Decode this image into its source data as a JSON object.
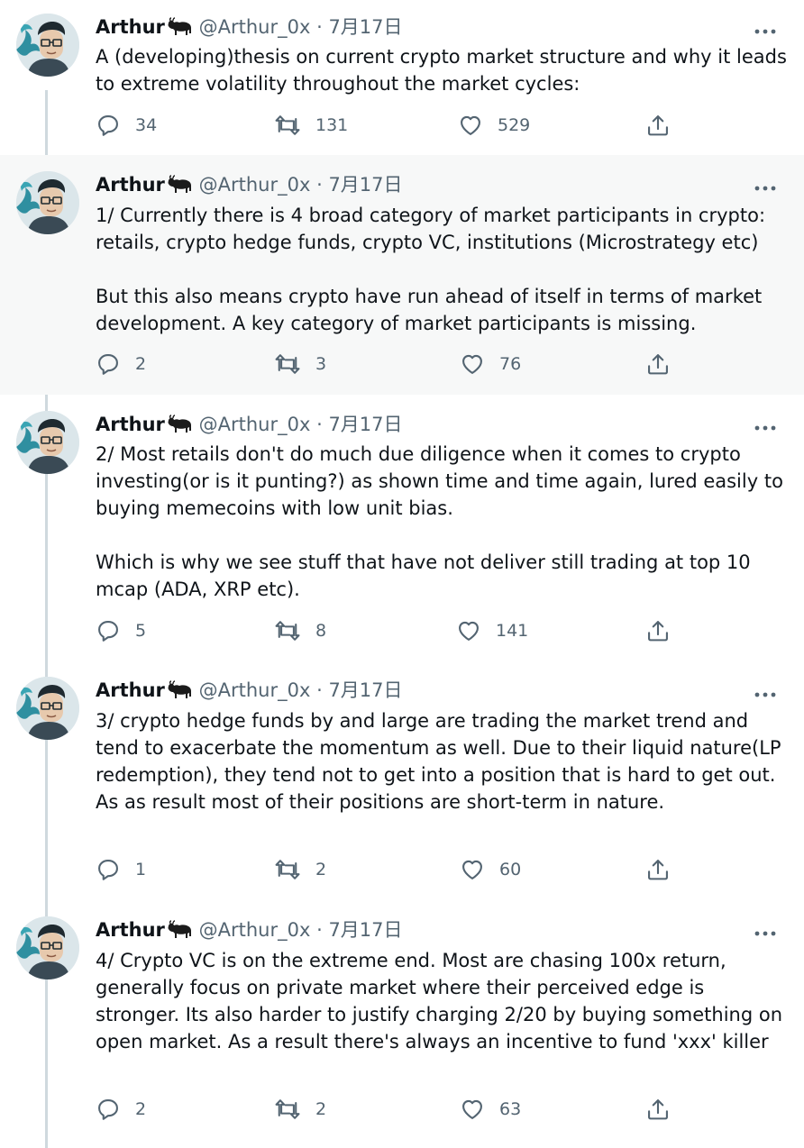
{
  "user": {
    "name": "Arthur",
    "handle": "@Arthur_0x",
    "separator": "·",
    "name_badge_icon": "bull-emoji"
  },
  "labels": {
    "more_icon": "more-options-icon",
    "reply_icon": "reply-icon",
    "retweet_icon": "retweet-icon",
    "like_icon": "heart-icon",
    "share_icon": "share-icon"
  },
  "colors": {
    "text": "#0f1419",
    "secondary": "#536471",
    "thread_line": "#cfd9de",
    "highlight_bg": "#f7f8f8"
  },
  "tweets": [
    {
      "date": "7月17日",
      "paragraphs": [
        "A (developing)thesis on current crypto market structure and why it leads to extreme volatility throughout the market cycles:"
      ],
      "replies": "34",
      "retweets": "131",
      "likes": "529"
    },
    {
      "date": "7月17日",
      "paragraphs": [
        "1/ Currently there is 4 broad category of market participants in crypto: retails, crypto hedge funds, crypto VC, institutions (Microstrategy etc)",
        "But this also means crypto have run ahead of itself in terms of market development. A key category of market participants is missing."
      ],
      "replies": "2",
      "retweets": "3",
      "likes": "76"
    },
    {
      "date": "7月17日",
      "paragraphs": [
        "2/ Most retails don't do much due diligence when it comes to crypto investing(or is it punting?) as shown time and time again, lured easily to buying memecoins with low unit bias.",
        "Which is why we see stuff that have not deliver still trading at top 10 mcap (ADA, XRP etc)."
      ],
      "replies": "5",
      "retweets": "8",
      "likes": "141"
    },
    {
      "date": "7月17日",
      "paragraphs": [
        "3/ crypto hedge funds by and large are trading the market trend and tend to exacerbate the momentum as well. Due to their liquid nature(LP redemption), they tend not to get into a position that is hard to get out. As as result most of their positions are short-term in nature."
      ],
      "replies": "1",
      "retweets": "2",
      "likes": "60"
    },
    {
      "date": "7月17日",
      "paragraphs": [
        "4/ Crypto VC is on the extreme end. Most are chasing 100x return, generally focus on private market where their perceived edge is stronger. Its also harder to justify charging 2/20 by buying something on open market. As a result there's always an incentive to fund 'xxx' killer"
      ],
      "replies": "2",
      "retweets": "2",
      "likes": "63"
    }
  ]
}
